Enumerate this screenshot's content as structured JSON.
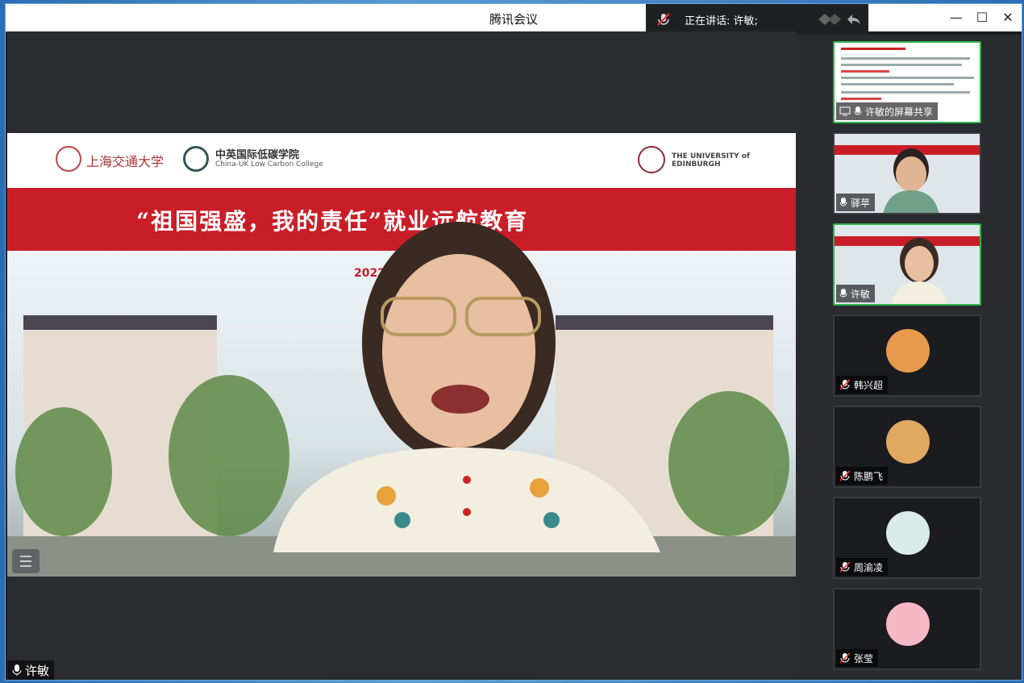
{
  "window": {
    "title": "腾讯会议"
  },
  "speaking": {
    "label": "正在讲话: 许敏;"
  },
  "main": {
    "speaker_name": "许敏",
    "slide": {
      "heading": "“祖国强盛，我的责任”就业远航教育",
      "year": "2022",
      "logo_left_1": "上海交通大学",
      "logo_left_2": "中英国际低碳学院",
      "logo_left_2_sub": "China-UK Low Carbon College",
      "logo_right": "THE UNIVERSITY of EDINBURGH"
    }
  },
  "participants": [
    {
      "name": "许敏的屏幕共享",
      "muted": false,
      "kind": "screen"
    },
    {
      "name": "驿苹",
      "muted": false,
      "kind": "video"
    },
    {
      "name": "许敏",
      "muted": false,
      "kind": "video"
    },
    {
      "name": "韩兴超",
      "muted": true,
      "kind": "avatar",
      "avatar": "tiger-avatar"
    },
    {
      "name": "陈鹏飞",
      "muted": true,
      "kind": "avatar",
      "avatar": "dog-avatar"
    },
    {
      "name": "周渝凌",
      "muted": true,
      "kind": "avatar",
      "avatar": "cartoon-avatar"
    },
    {
      "name": "张莹",
      "muted": true,
      "kind": "avatar",
      "avatar": "pig-avatar"
    }
  ],
  "colors": {
    "active_border": "#2bb44a",
    "banner_red": "#c91e28",
    "panel_bg": "#2a2b2f"
  }
}
